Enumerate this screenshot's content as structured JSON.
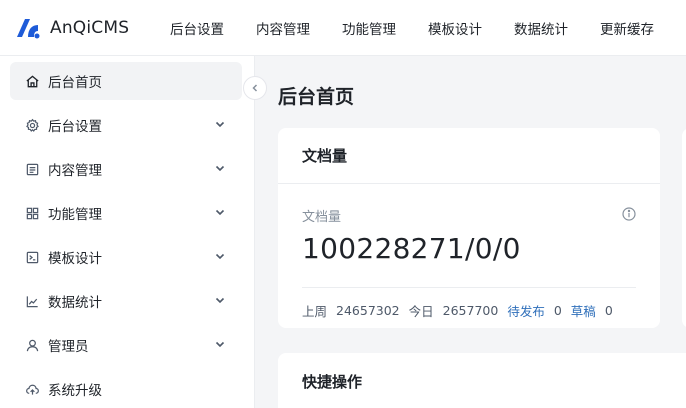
{
  "brand": {
    "name": "AnQiCMS",
    "accent": "#1e5bd8"
  },
  "topnav": [
    {
      "label": "后台设置"
    },
    {
      "label": "内容管理"
    },
    {
      "label": "功能管理"
    },
    {
      "label": "模板设计"
    },
    {
      "label": "数据统计"
    },
    {
      "label": "更新缓存"
    }
  ],
  "sidebar": {
    "items": [
      {
        "label": "后台首页",
        "icon": "home-icon",
        "active": true
      },
      {
        "label": "后台设置",
        "icon": "gear-icon"
      },
      {
        "label": "内容管理",
        "icon": "document-icon"
      },
      {
        "label": "功能管理",
        "icon": "grid-icon"
      },
      {
        "label": "模板设计",
        "icon": "terminal-icon"
      },
      {
        "label": "数据统计",
        "icon": "chart-line-icon"
      },
      {
        "label": "管理员",
        "icon": "user-icon"
      },
      {
        "label": "系统升级",
        "icon": "cloud-upgrade-icon"
      }
    ]
  },
  "main": {
    "title": "后台首页",
    "doc_card": {
      "title": "文档量",
      "stat_label": "文档量",
      "stat_value": "100228271/0/0",
      "last_week_label": "上周",
      "last_week_value": "24657302",
      "today_label": "今日",
      "today_value": "2657700",
      "pending_label": "待发布",
      "pending_value": "0",
      "draft_label": "草稿",
      "draft_value": "0"
    },
    "quick_card": {
      "title": "快捷操作"
    }
  }
}
